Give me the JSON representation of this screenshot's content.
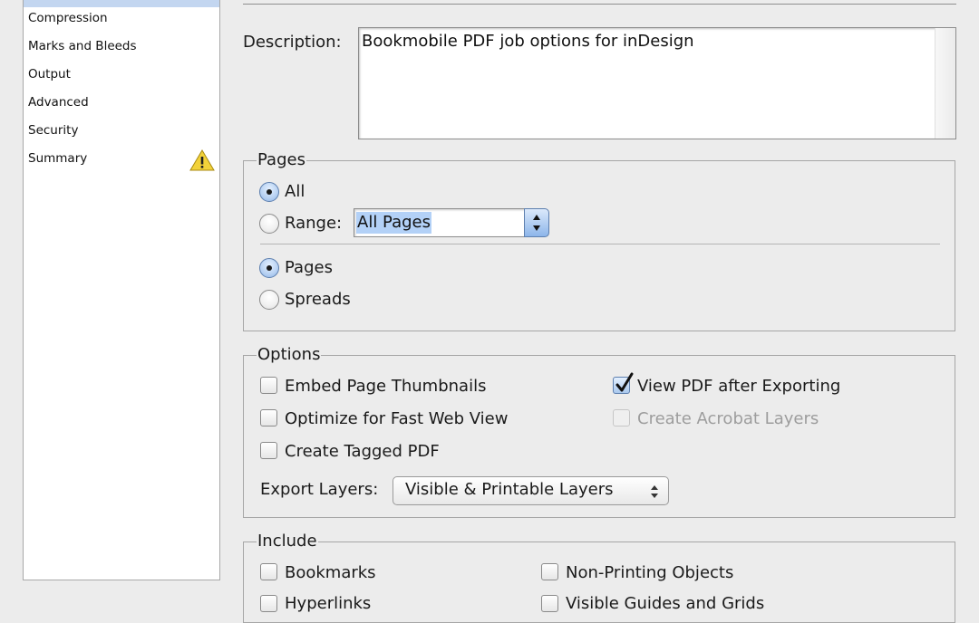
{
  "sidebar": {
    "items": [
      {
        "label": "Compression"
      },
      {
        "label": "Marks and Bleeds"
      },
      {
        "label": "Output"
      },
      {
        "label": "Advanced"
      },
      {
        "label": "Security"
      },
      {
        "label": "Summary"
      }
    ],
    "summary_icon": "warning-icon"
  },
  "description": {
    "label": "Description:",
    "value": "Bookmobile PDF job options for inDesign"
  },
  "pages": {
    "title": "Pages",
    "all_label": "All",
    "range_label": "Range:",
    "range_value": "All Pages",
    "pages_label": "Pages",
    "spreads_label": "Spreads",
    "selected_scope": "All",
    "selected_layout": "Pages"
  },
  "options": {
    "title": "Options",
    "embed_thumbnails": {
      "label": "Embed Page Thumbnails",
      "checked": false
    },
    "optimize_web": {
      "label": "Optimize for Fast Web View",
      "checked": false
    },
    "tagged_pdf": {
      "label": "Create Tagged PDF",
      "checked": false
    },
    "view_after": {
      "label": "View PDF after Exporting",
      "checked": true
    },
    "acrobat_layers": {
      "label": "Create Acrobat Layers",
      "checked": false,
      "disabled": true
    },
    "export_layers_label": "Export Layers:",
    "export_layers_value": "Visible & Printable Layers"
  },
  "include": {
    "title": "Include",
    "bookmarks": {
      "label": "Bookmarks",
      "checked": false
    },
    "hyperlinks": {
      "label": "Hyperlinks",
      "checked": false
    },
    "non_printing": {
      "label": "Non-Printing Objects",
      "checked": false
    },
    "guides_grids": {
      "label": "Visible Guides and Grids",
      "checked": false
    }
  },
  "colors": {
    "window_bg": "#ececec",
    "selection": "#b3d1f7",
    "accent": "#5d7fae",
    "warning": "#f2d23a"
  }
}
